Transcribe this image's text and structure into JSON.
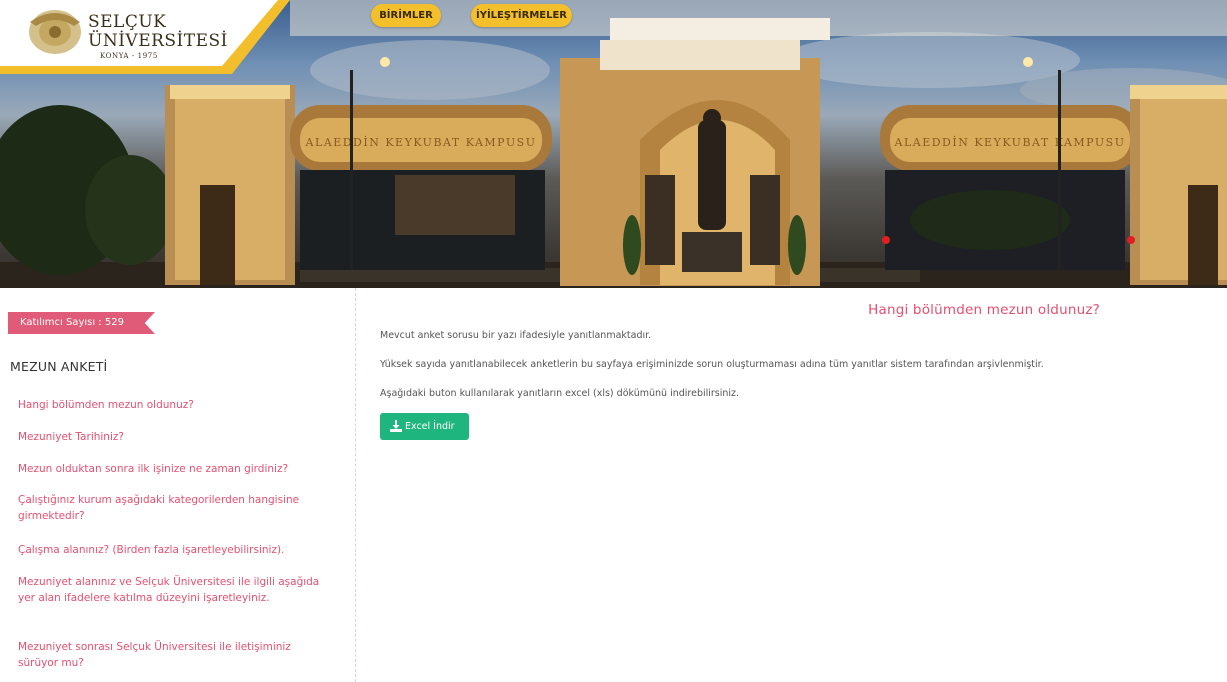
{
  "header": {
    "logo": {
      "name_line1": "SELÇUK",
      "name_line2": "ÜNİVERSİTESİ",
      "city_line": "KONYA - 1975",
      "emblem_icon": "university-emblem-icon"
    },
    "nav": [
      {
        "label": "BİRİMLER"
      },
      {
        "label": "İYİLEŞTİRMELER"
      }
    ],
    "banner": {
      "gate_sign_left": "ALAEDDİN KEYKUBAT KAMPUSU",
      "gate_sign_right": "ALAEDDİN KEYKUBAT KAMPUSU"
    }
  },
  "sidebar": {
    "participant_count": "Katılımcı Sayısı : 529",
    "survey_title": "MEZUN ANKETİ",
    "questions": [
      {
        "label": "Hangi bölümden mezun oldunuz?"
      },
      {
        "label": "Mezuniyet Tarihiniz?"
      },
      {
        "label": "Mezun olduktan sonra ilk işinize ne zaman girdiniz?"
      },
      {
        "label": "Çalıştığınız kurum aşağıdaki kategorilerden hangisine girmektedir?"
      },
      {
        "label": "Çalışma alanınız? (Birden fazla işaretleyebilirsiniz)."
      },
      {
        "label": "Mezuniyet alanınız ve Selçuk Üniversitesi ile ilgili aşağıda yer alan ifadelere katılma düzeyini işaretleyiniz."
      },
      {
        "label": "Mezuniyet sonrası Selçuk Üniversitesi ile iletişiminiz sürüyor mu?"
      }
    ]
  },
  "main": {
    "question_title": "Hangi bölümden mezun oldunuz?",
    "paragraphs": [
      "Mevcut anket sorusu bir yazı ifadesiyle yanıtlanmaktadır.",
      "Yüksek sayıda yanıtlanabilecek anketlerin bu sayfaya erişiminizde sorun oluşturmaması adına tüm yanıtlar sistem tarafından arşivlenmiştir.",
      "Aşağıdaki buton kullanılarak yanıtların excel (xls) dökümünü indirebilirsiniz."
    ],
    "excel_button": {
      "label": "Excel İndir",
      "icon": "download-icon"
    }
  },
  "colors": {
    "accent_pink": "#e3506f",
    "badge_pink": "#e05b78",
    "nav_gold": "#f3bf2a",
    "button_green": "#1fb57e"
  }
}
